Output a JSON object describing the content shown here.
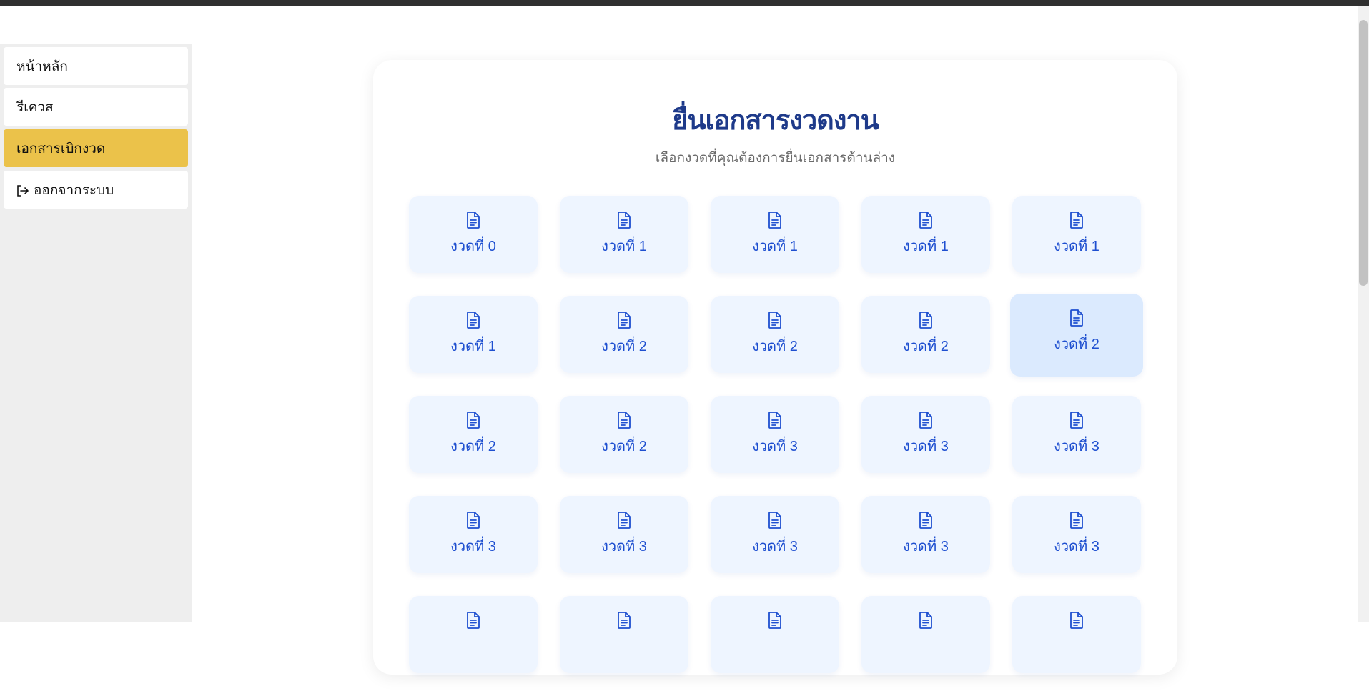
{
  "sidebar": {
    "items": [
      {
        "label": "หน้าหลัก",
        "active": false
      },
      {
        "label": "รีเควส",
        "active": false
      },
      {
        "label": "เอกสารเบิกงวด",
        "active": true
      },
      {
        "label": "ออกจากระบบ",
        "icon": "logout-icon",
        "active": false
      }
    ]
  },
  "main": {
    "title": "ยื่นเอกสารงวดงาน",
    "subtitle": "เลือกงวดที่คุณต้องการยื่นเอกสารด้านล่าง",
    "tile_icon": "document-icon",
    "tiles": [
      "งวดที่ 0",
      "งวดที่ 1",
      "งวดที่ 1",
      "งวดที่ 1",
      "งวดที่ 1",
      "งวดที่ 1",
      "งวดที่ 2",
      "งวดที่ 2",
      "งวดที่ 2",
      "งวดที่ 2",
      "งวดที่ 2",
      "งวดที่ 2",
      "งวดที่ 3",
      "งวดที่ 3",
      "งวดที่ 3",
      "งวดที่ 3",
      "งวดที่ 3",
      "งวดที่ 3",
      "งวดที่ 3",
      "งวดที่ 3",
      "",
      "",
      "",
      "",
      ""
    ],
    "highlighted_tile_index": 9
  },
  "colors": {
    "accent": "#ebc24a",
    "title": "#1e3a8a",
    "tile_bg": "#eef5ff",
    "tile_text": "#1e4fd0"
  }
}
